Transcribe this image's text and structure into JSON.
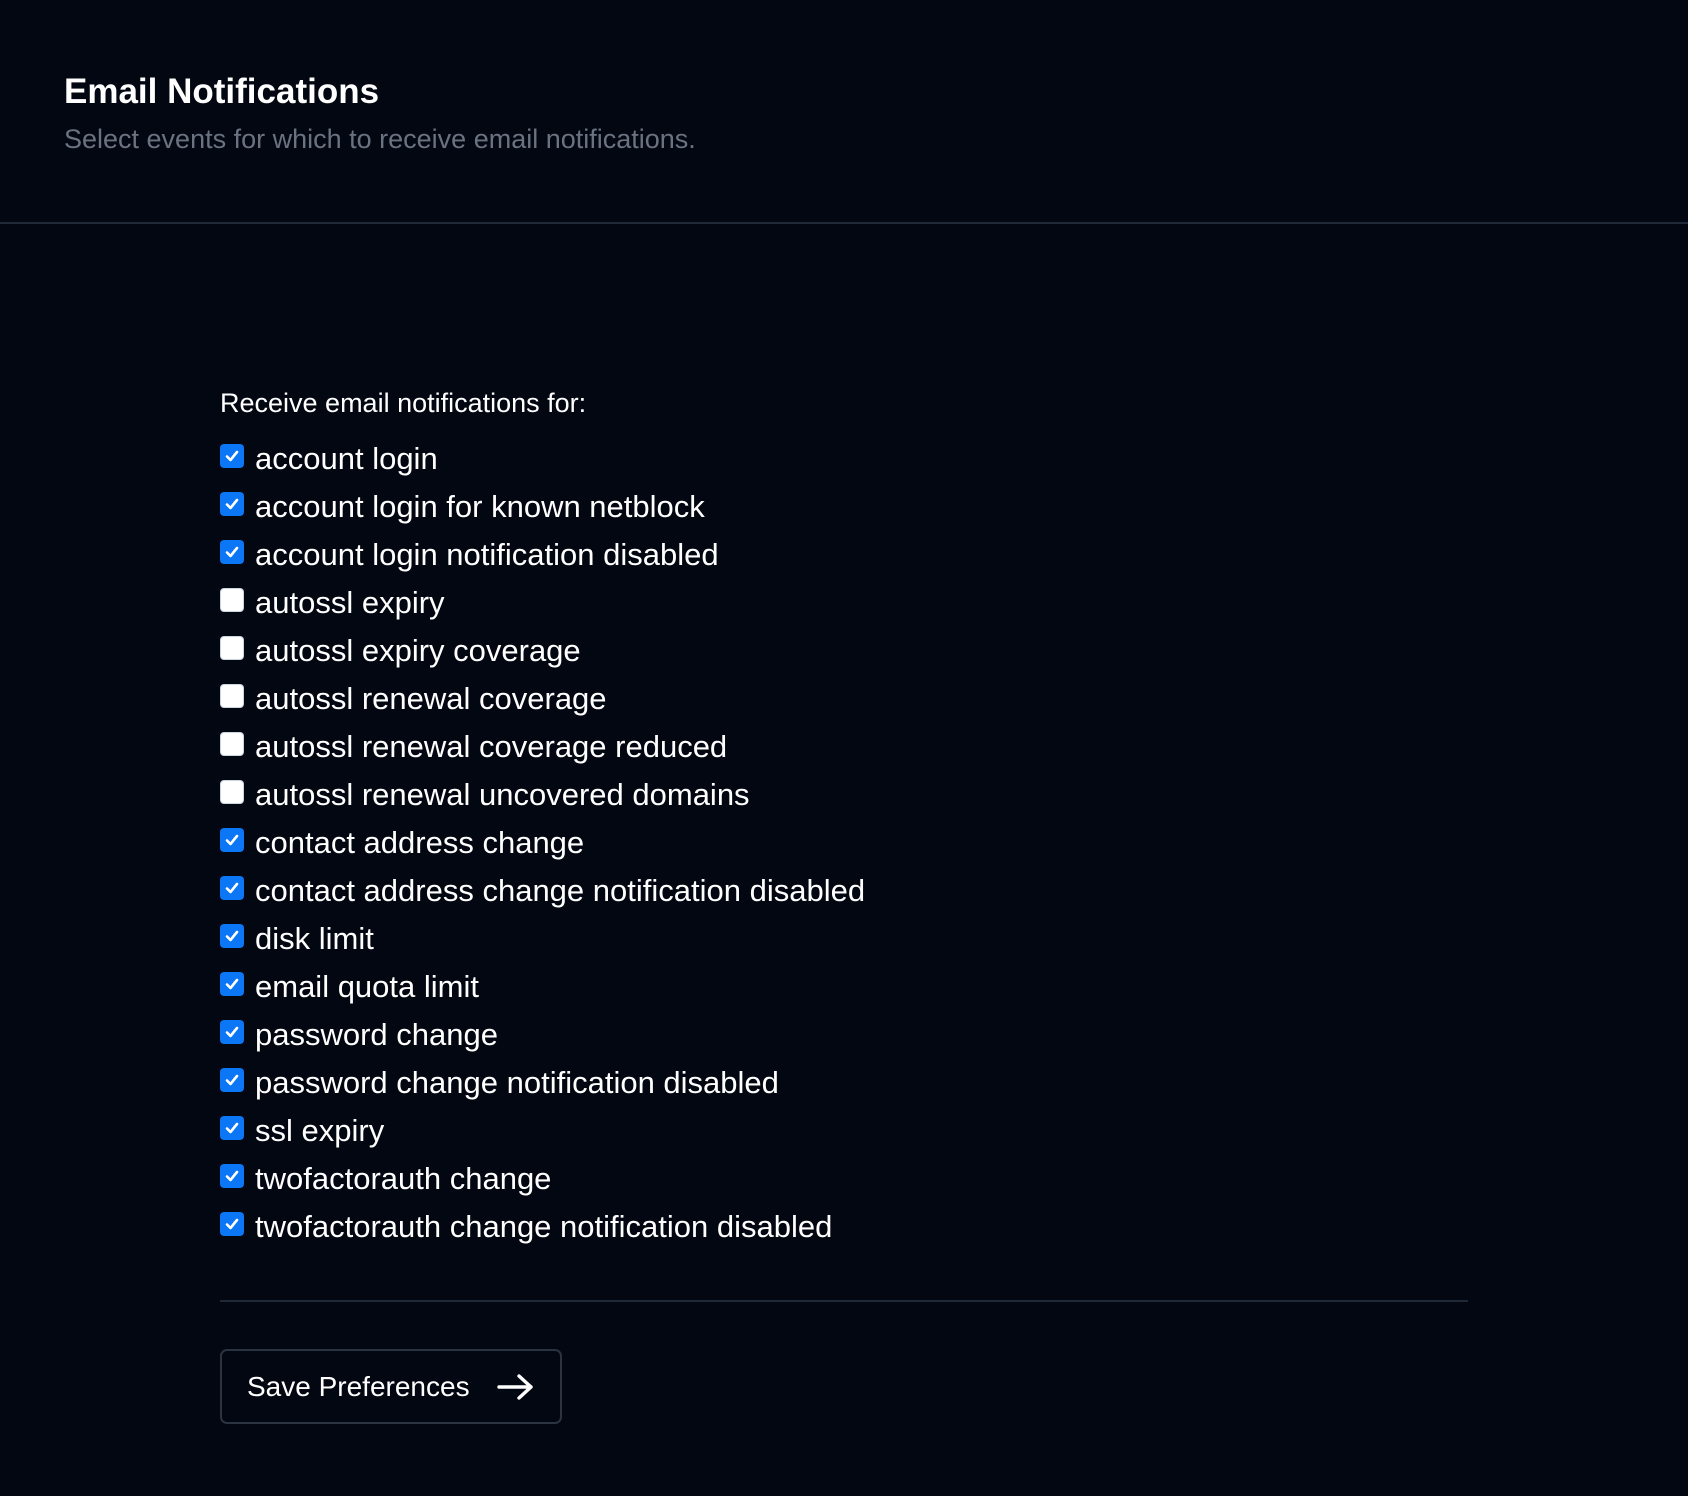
{
  "header": {
    "title": "Email Notifications",
    "subtitle": "Select events for which to receive email notifications."
  },
  "form": {
    "caption": "Receive email notifications for:",
    "options": [
      {
        "label": "account login",
        "checked": true
      },
      {
        "label": "account login for known netblock",
        "checked": true
      },
      {
        "label": "account login notification disabled",
        "checked": true
      },
      {
        "label": "autossl expiry",
        "checked": false
      },
      {
        "label": "autossl expiry coverage",
        "checked": false
      },
      {
        "label": "autossl renewal coverage",
        "checked": false
      },
      {
        "label": "autossl renewal coverage reduced",
        "checked": false
      },
      {
        "label": "autossl renewal uncovered domains",
        "checked": false
      },
      {
        "label": "contact address change",
        "checked": true
      },
      {
        "label": "contact address change notification disabled",
        "checked": true
      },
      {
        "label": "disk limit",
        "checked": true
      },
      {
        "label": "email quota limit",
        "checked": true
      },
      {
        "label": "password change",
        "checked": true
      },
      {
        "label": "password change notification disabled",
        "checked": true
      },
      {
        "label": "ssl expiry",
        "checked": true
      },
      {
        "label": "twofactorauth change",
        "checked": true
      },
      {
        "label": "twofactorauth change notification disabled",
        "checked": true
      }
    ],
    "save_label": "Save Preferences",
    "save_icon": "arrow-right-icon"
  },
  "colors": {
    "background": "#030712",
    "checkbox_checked": "#0b76f6",
    "subtitle": "#6b7280",
    "divider": "#1f2937"
  }
}
